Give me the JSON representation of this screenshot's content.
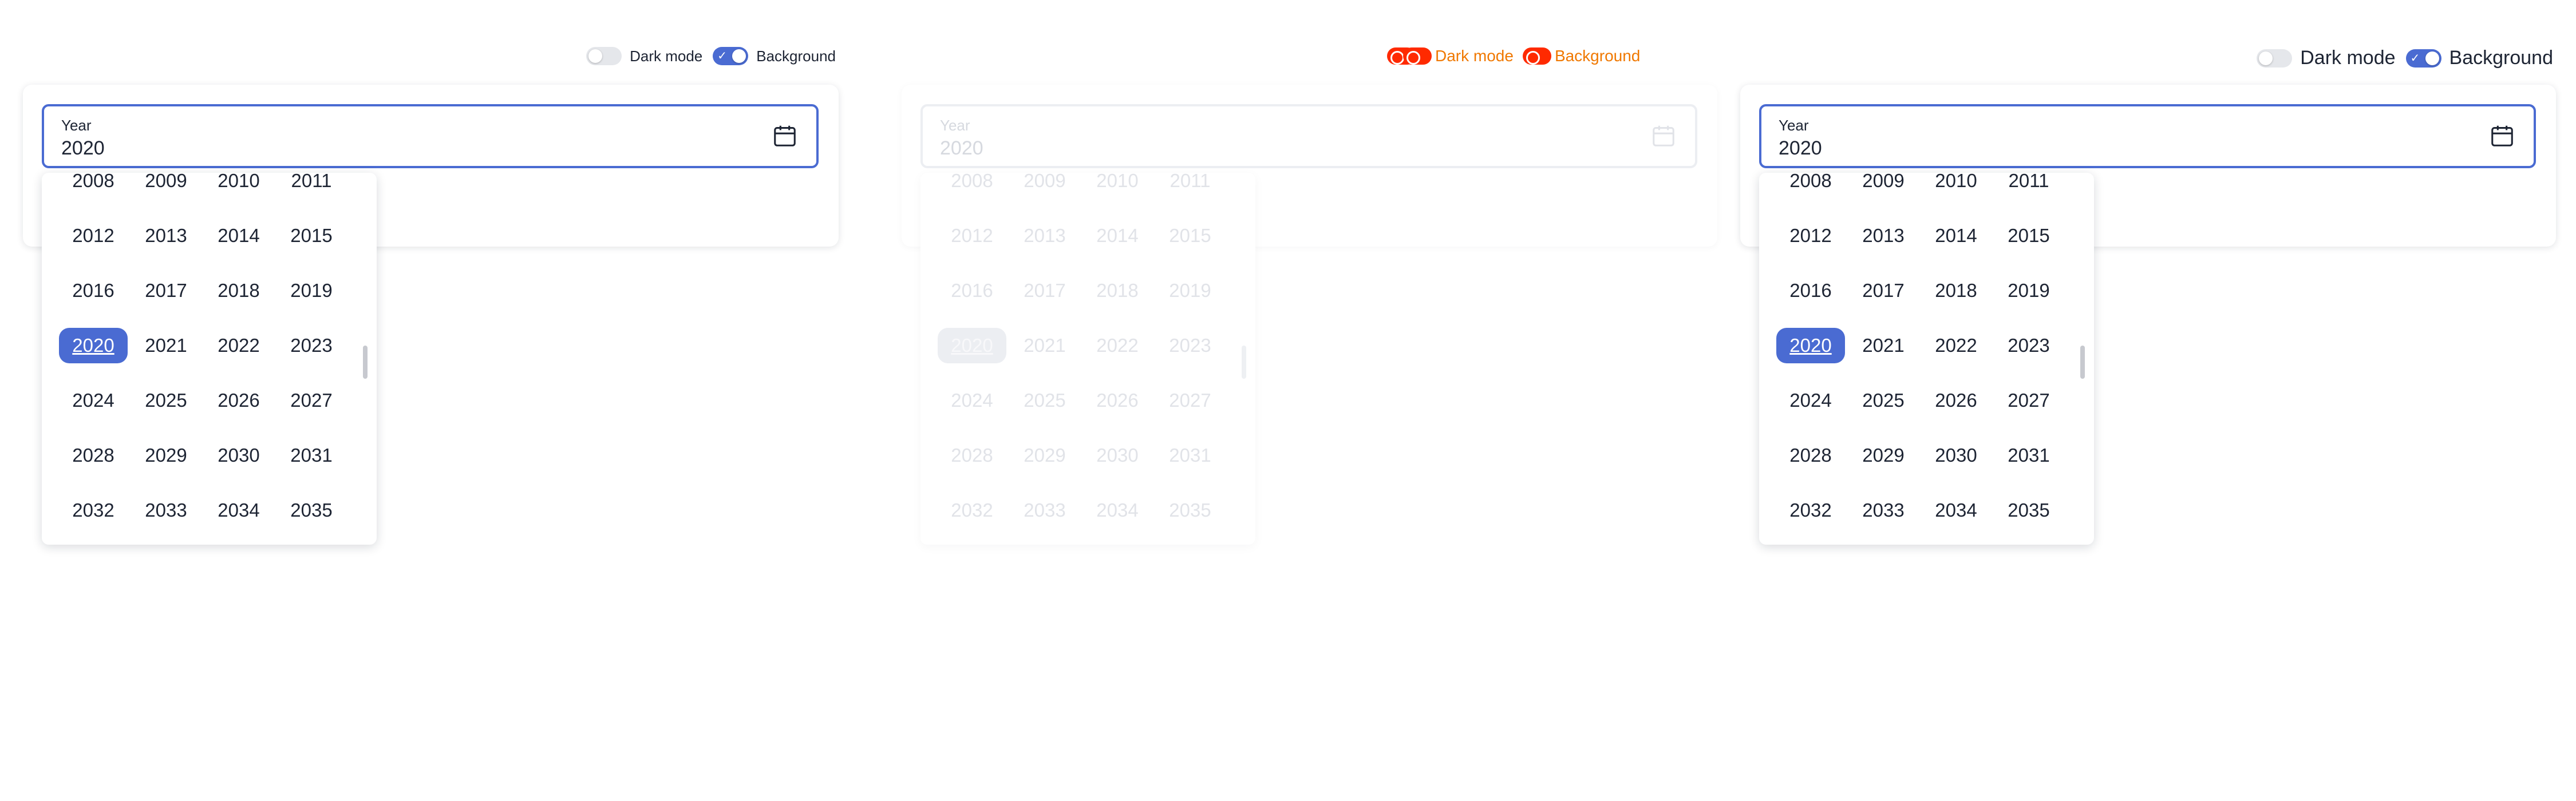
{
  "panels": [
    {
      "toggles": [
        {
          "label": "Dark mode",
          "on": false
        },
        {
          "label": "Background",
          "on": true
        }
      ],
      "field": {
        "label": "Year",
        "value": "2020"
      },
      "years": [
        "2008",
        "2009",
        "2010",
        "2011",
        "2012",
        "2013",
        "2014",
        "2015",
        "2016",
        "2017",
        "2018",
        "2019",
        "2020",
        "2021",
        "2022",
        "2023",
        "2024",
        "2025",
        "2026",
        "2027",
        "2028",
        "2029",
        "2030",
        "2031",
        "2032",
        "2033",
        "2034",
        "2035"
      ],
      "selected_year": "2020"
    },
    {
      "toggles_glitch": [
        "Dark mode",
        "Background"
      ],
      "field": {
        "label": "Year",
        "value": "2020"
      },
      "years": [
        "2008",
        "2009",
        "2010",
        "2011",
        "2012",
        "2013",
        "2014",
        "2015",
        "2016",
        "2017",
        "2018",
        "2019",
        "2020",
        "2021",
        "2022",
        "2023",
        "2024",
        "2025",
        "2026",
        "2027",
        "2028",
        "2029",
        "2030",
        "2031",
        "2032",
        "2033",
        "2034",
        "2035"
      ],
      "selected_year": "2020"
    },
    {
      "toggles": [
        {
          "label": "Dark mode",
          "on": false
        },
        {
          "label": "Background",
          "on": true
        }
      ],
      "field": {
        "label": "Year",
        "value": "2020"
      },
      "years": [
        "2008",
        "2009",
        "2010",
        "2011",
        "2012",
        "2013",
        "2014",
        "2015",
        "2016",
        "2017",
        "2018",
        "2019",
        "2020",
        "2021",
        "2022",
        "2023",
        "2024",
        "2025",
        "2026",
        "2027",
        "2028",
        "2029",
        "2030",
        "2031",
        "2032",
        "2033",
        "2034",
        "2035"
      ],
      "selected_year": "2020"
    }
  ],
  "colors": {
    "accent": "#4a6bd2",
    "text": "#1d2433",
    "glitch_red": "#ff2a00",
    "glitch_orange": "#f07800"
  },
  "icons": {
    "field_icon": "calendar-icon",
    "check": "check-icon"
  }
}
